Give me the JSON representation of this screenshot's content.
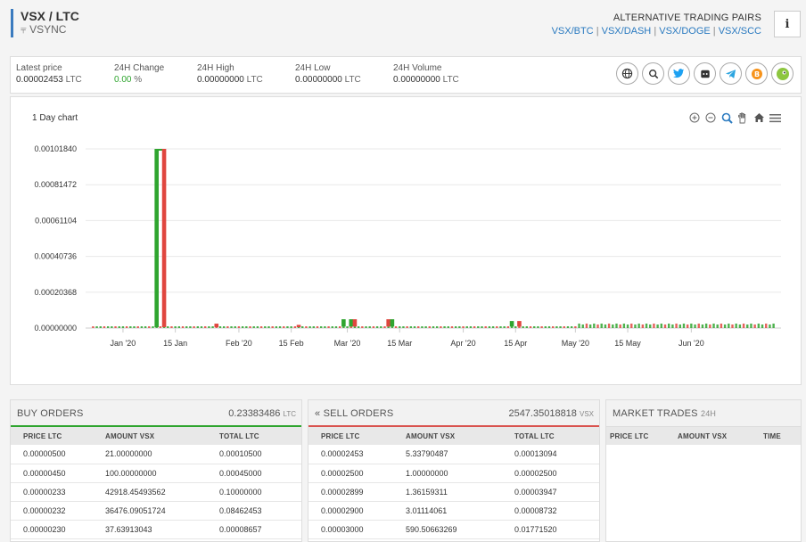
{
  "header": {
    "pair": "VSX / LTC",
    "coin_name": "VSYNC",
    "alt_title": "ALTERNATIVE TRADING PAIRS",
    "alt_links": [
      "VSX/BTC",
      "VSX/DASH",
      "VSX/DOGE",
      "VSX/SCC"
    ],
    "info": "i"
  },
  "stats": {
    "latest_label": "Latest price",
    "latest_value": "0.00002453",
    "latest_unit": "LTC",
    "change_label": "24H Change",
    "change_value": "0.00",
    "change_unit": "%",
    "high_label": "24H High",
    "high_value": "0.00000000",
    "high_unit": "LTC",
    "low_label": "24H Low",
    "low_value": "0.00000000",
    "low_unit": "LTC",
    "volume_label": "24H Volume",
    "volume_value": "0.00000000",
    "volume_unit": "LTC"
  },
  "social_icons": [
    "globe-icon",
    "search-icon",
    "twitter-icon",
    "discord-icon",
    "telegram-icon",
    "bitcointalk-icon",
    "coingecko-icon"
  ],
  "colors": {
    "up": "#2fa52f",
    "down": "#e0463f",
    "accent": "#2a7ac0"
  },
  "chart": {
    "title": "1 Day chart",
    "toolbar_icons": [
      "zoom-in-icon",
      "zoom-out-icon",
      "zoom-select-icon",
      "pan-icon",
      "home-icon",
      "menu-icon"
    ]
  },
  "chart_data": {
    "type": "candlestick",
    "y_ticks": [
      "0.00000000",
      "0.00020368",
      "0.00040736",
      "0.00061104",
      "0.00081472",
      "0.00101840"
    ],
    "ylim": [
      0,
      0.0010184
    ],
    "x_ticks": [
      "Jan '20",
      "15 Jan",
      "Feb '20",
      "15 Feb",
      "Mar '20",
      "15 Mar",
      "Apr '20",
      "15 Apr",
      "May '20",
      "15 May",
      "Jun '20"
    ],
    "spikes": [
      {
        "date": "2020-01-10",
        "open": 5e-06,
        "close": 0.0010184,
        "dir": "up"
      },
      {
        "date": "2020-01-11",
        "open": 0.0010184,
        "close": 0.0010184,
        "dir": "up"
      },
      {
        "date": "2020-01-12",
        "open": 0.0010184,
        "close": 5e-06,
        "dir": "down"
      },
      {
        "date": "2020-01-26",
        "open": 2.5e-05,
        "close": 5e-06,
        "dir": "down"
      },
      {
        "date": "2020-02-17",
        "open": 5e-06,
        "close": 1.8e-05,
        "dir": "down"
      },
      {
        "date": "2020-02-29",
        "open": 8e-06,
        "close": 5e-05,
        "dir": "up"
      },
      {
        "date": "2020-03-02",
        "open": 5e-05,
        "close": 8e-06,
        "dir": "up"
      },
      {
        "date": "2020-03-03",
        "open": 5e-05,
        "close": 8e-06,
        "dir": "down"
      },
      {
        "date": "2020-03-12",
        "open": 5e-05,
        "close": 8e-06,
        "dir": "down"
      },
      {
        "date": "2020-03-13",
        "open": 5e-05,
        "close": 8e-06,
        "dir": "up"
      },
      {
        "date": "2020-04-14",
        "open": 8e-06,
        "close": 4e-05,
        "dir": "up"
      },
      {
        "date": "2020-04-16",
        "open": 4e-05,
        "close": 8e-06,
        "dir": "down"
      }
    ]
  },
  "buy_orders": {
    "title": "BUY ORDERS",
    "total": "0.23383486",
    "total_unit": "LTC",
    "columns": [
      "PRICE LTC",
      "AMOUNT VSX",
      "TOTAL LTC"
    ],
    "rows": [
      [
        "0.00000500",
        "21.00000000",
        "0.00010500"
      ],
      [
        "0.00000450",
        "100.00000000",
        "0.00045000"
      ],
      [
        "0.00000233",
        "42918.45493562",
        "0.10000000"
      ],
      [
        "0.00000232",
        "36476.09051724",
        "0.08462453"
      ],
      [
        "0.00000230",
        "37.63913043",
        "0.00008657"
      ]
    ]
  },
  "sell_orders": {
    "title": "« SELL ORDERS",
    "total": "2547.35018818",
    "total_unit": "VSX",
    "columns": [
      "PRICE LTC",
      "AMOUNT VSX",
      "TOTAL LTC"
    ],
    "rows": [
      [
        "0.00002453",
        "5.33790487",
        "0.00013094"
      ],
      [
        "0.00002500",
        "1.00000000",
        "0.00002500"
      ],
      [
        "0.00002899",
        "1.36159311",
        "0.00003947"
      ],
      [
        "0.00002900",
        "3.01114061",
        "0.00008732"
      ],
      [
        "0.00003000",
        "590.50663269",
        "0.01771520"
      ]
    ]
  },
  "market_trades": {
    "title": "MARKET TRADES",
    "suffix": "24H",
    "columns": [
      "PRICE LTC",
      "AMOUNT VSX",
      "TIME"
    ]
  }
}
